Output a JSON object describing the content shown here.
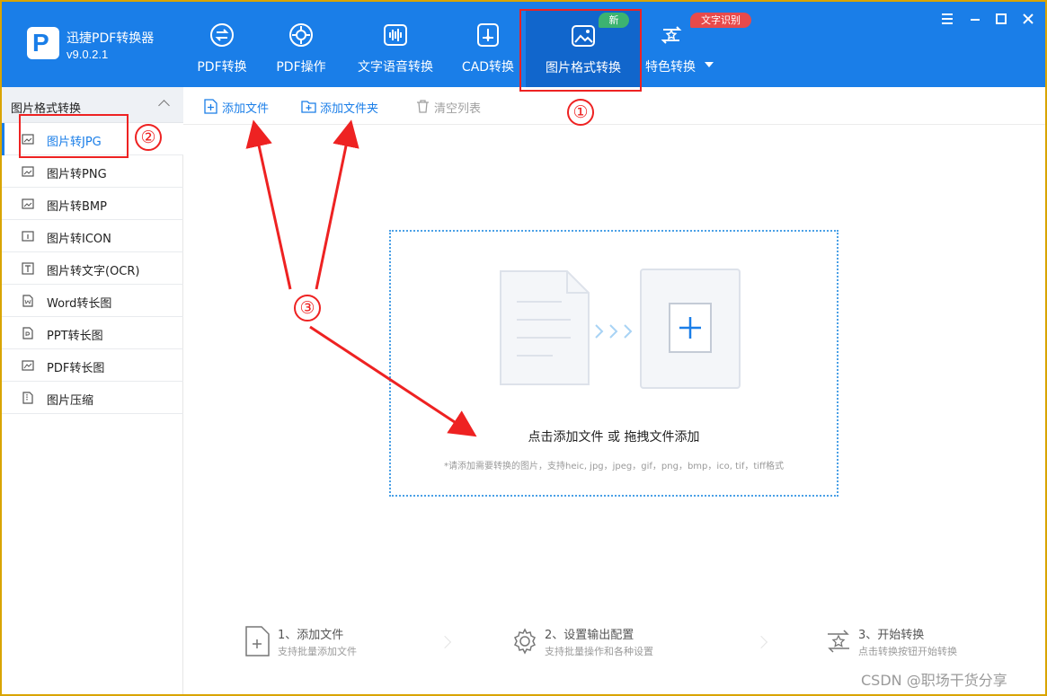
{
  "app": {
    "name": "迅捷PDF转换器",
    "version": "v9.0.2.1",
    "logo_letter": "P"
  },
  "nav": {
    "items": [
      {
        "label": "PDF转换",
        "icon": "pdf-convert-icon"
      },
      {
        "label": "PDF操作",
        "icon": "pdf-operate-icon"
      },
      {
        "label": "文字语音转换",
        "icon": "voice-wave-icon"
      },
      {
        "label": "CAD转换",
        "icon": "cad-icon"
      },
      {
        "label": "图片格式转换",
        "icon": "image-icon",
        "active": true
      },
      {
        "label": "特色转换",
        "icon": "star-swap-icon"
      }
    ],
    "badge_new": "新",
    "badge_ocr": "文字识别"
  },
  "window_controls": [
    "menu-icon",
    "minimize-icon",
    "maximize-icon",
    "close-icon"
  ],
  "sidebar": {
    "header": "图片格式转换",
    "items": [
      {
        "label": "图片转JPG",
        "active": true
      },
      {
        "label": "图片转PNG"
      },
      {
        "label": "图片转BMP"
      },
      {
        "label": "图片转ICON"
      },
      {
        "label": "图片转文字(OCR)"
      },
      {
        "label": "Word转长图"
      },
      {
        "label": "PPT转长图"
      },
      {
        "label": "PDF转长图"
      },
      {
        "label": "图片压缩"
      }
    ]
  },
  "toolbar": {
    "add_file": "添加文件",
    "add_folder": "添加文件夹",
    "clear_list": "清空列表"
  },
  "dropzone": {
    "main": "点击添加文件 或 拖拽文件添加",
    "hint": "*请添加需要转换的图片，支持heic, jpg，jpeg，gif，png，bmp，ico, tif，tiff格式"
  },
  "steps": [
    {
      "title": "1、添加文件",
      "sub": "支持批量添加文件"
    },
    {
      "title": "2、设置输出配置",
      "sub": "支持批量操作和各种设置"
    },
    {
      "title": "3、开始转换",
      "sub": "点击转换按钮开始转换"
    }
  ],
  "annotations": {
    "one": "①",
    "two": "②",
    "three": "③"
  },
  "watermark": "CSDN @职场干货分享",
  "colors": {
    "brand": "#1a7ee8",
    "annotation": "#ee2222",
    "new_badge": "#3cb371",
    "ocr_badge": "#e84a4a"
  }
}
